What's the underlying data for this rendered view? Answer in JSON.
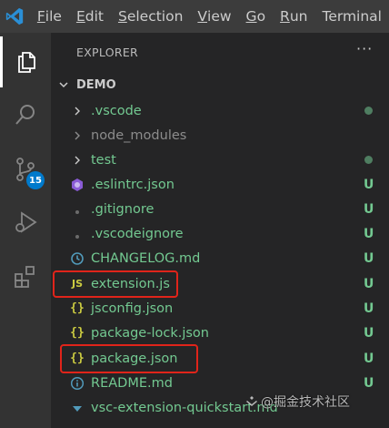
{
  "menubar": {
    "items": [
      {
        "mnemonic": "F",
        "rest": "ile"
      },
      {
        "mnemonic": "E",
        "rest": "dit"
      },
      {
        "mnemonic": "S",
        "rest": "election"
      },
      {
        "mnemonic": "V",
        "rest": "iew"
      },
      {
        "mnemonic": "G",
        "rest": "o"
      },
      {
        "mnemonic": "R",
        "rest": "un"
      },
      {
        "mnemonic": "",
        "rest": "Terminal"
      }
    ]
  },
  "activitybar": {
    "items": [
      "explorer-icon",
      "search-icon",
      "source-control-icon",
      "run-debug-icon",
      "extensions-icon"
    ],
    "source_control_badge": "15",
    "badge_color": "#007acc"
  },
  "explorer": {
    "header": "EXPLORER",
    "more_actions": "···",
    "folder": "DEMO",
    "files": [
      {
        "name": ".vscode",
        "type": "folder",
        "icon": "chevron-right-icon",
        "status": "dot",
        "color": "#73c991"
      },
      {
        "name": "node_modules",
        "type": "folder",
        "icon": "chevron-right-icon",
        "status": "",
        "color": "#8c8c8c"
      },
      {
        "name": "test",
        "type": "folder",
        "icon": "chevron-right-icon",
        "status": "dot",
        "color": "#73c991"
      },
      {
        "name": ".eslintrc.json",
        "type": "file",
        "icon": "eslint-icon",
        "status": "U",
        "color": "#73c991"
      },
      {
        "name": ".gitignore",
        "type": "file",
        "icon": "git-icon",
        "status": "U",
        "color": "#73c991"
      },
      {
        "name": ".vscodeignore",
        "type": "file",
        "icon": "vscode-file-icon",
        "status": "U",
        "color": "#73c991"
      },
      {
        "name": "CHANGELOG.md",
        "type": "file",
        "icon": "markdown-clock-icon",
        "status": "U",
        "color": "#73c991"
      },
      {
        "name": "extension.js",
        "type": "file",
        "icon": "js-icon",
        "icon_text": "JS",
        "status": "U",
        "color": "#73c991"
      },
      {
        "name": "jsconfig.json",
        "type": "file",
        "icon": "json-icon",
        "icon_text": "{}",
        "status": "U",
        "color": "#73c991"
      },
      {
        "name": "package-lock.json",
        "type": "file",
        "icon": "json-icon",
        "icon_text": "{}",
        "status": "U",
        "color": "#73c991"
      },
      {
        "name": "package.json",
        "type": "file",
        "icon": "json-icon",
        "icon_text": "{}",
        "status": "U",
        "color": "#73c991"
      },
      {
        "name": "README.md",
        "type": "file",
        "icon": "info-icon",
        "status": "U",
        "color": "#73c991"
      },
      {
        "name": "vsc-extension-quickstart.md",
        "type": "file",
        "icon": "download-arrow-icon",
        "status": "",
        "color": "#73c991"
      }
    ],
    "highlighted": [
      "extension.js",
      "package.json"
    ],
    "highlight_color": "#e0241a"
  },
  "watermark": "@掘金技术社区"
}
